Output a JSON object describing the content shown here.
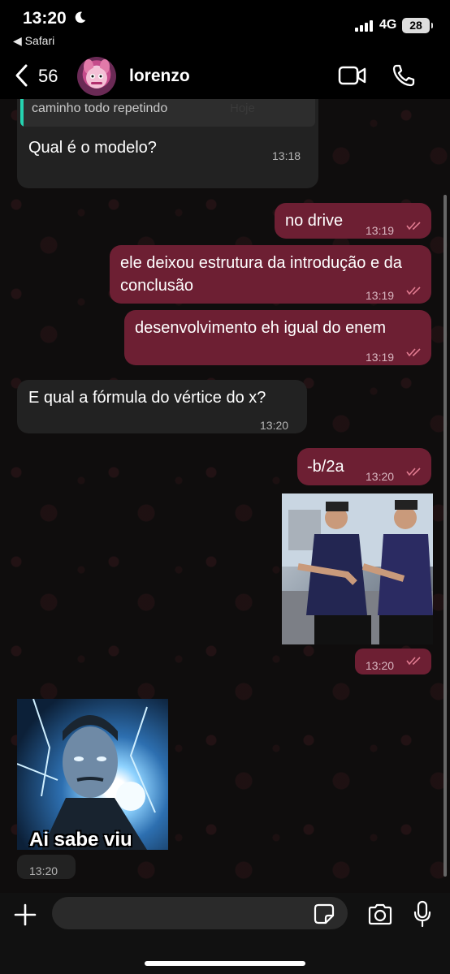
{
  "status_bar": {
    "time": "13:20",
    "back_to_app": "◀ Safari",
    "network": "4G",
    "battery": "28",
    "moon_icon": "moon-icon",
    "signal_icon": "signal-bars-icon"
  },
  "header": {
    "unread_count": "56",
    "contact_name": "lorenzo",
    "icons": [
      "chevron-left-icon",
      "video-call-icon",
      "phone-icon"
    ]
  },
  "chat": {
    "date_chip": "Hoje",
    "quoted_text": "decorei todo modelo da unisc pq fiquei o caminho todo repetindo",
    "messages": [
      {
        "direction": "in",
        "text": "Qual é o modelo?",
        "time": "13:18"
      },
      {
        "direction": "out",
        "text": "no drive",
        "time": "13:19"
      },
      {
        "direction": "out",
        "text": "ele deixou estrutura da introdução e da conclusão",
        "time": "13:19"
      },
      {
        "direction": "out",
        "text": "desenvolvimento eh igual do enem",
        "time": "13:19"
      },
      {
        "direction": "in",
        "text": "E qual a fórmula do vértice do x?",
        "time": "13:20"
      },
      {
        "direction": "out",
        "text": "-b/2a",
        "time": "13:20"
      },
      {
        "direction": "out",
        "type": "image",
        "time": "13:20"
      },
      {
        "direction": "in",
        "type": "image",
        "caption": "Ai sabe viu",
        "time": "13:20"
      }
    ]
  },
  "colors": {
    "outgoing_bubble": "#6d1f33",
    "incoming_bubble": "#222222",
    "quote_accent": "#25d3b0",
    "read_ticks": "#e07a8f"
  },
  "input_bar": {
    "placeholder": "",
    "icons": [
      "plus-icon",
      "sticker-icon",
      "camera-icon",
      "microphone-icon"
    ]
  }
}
